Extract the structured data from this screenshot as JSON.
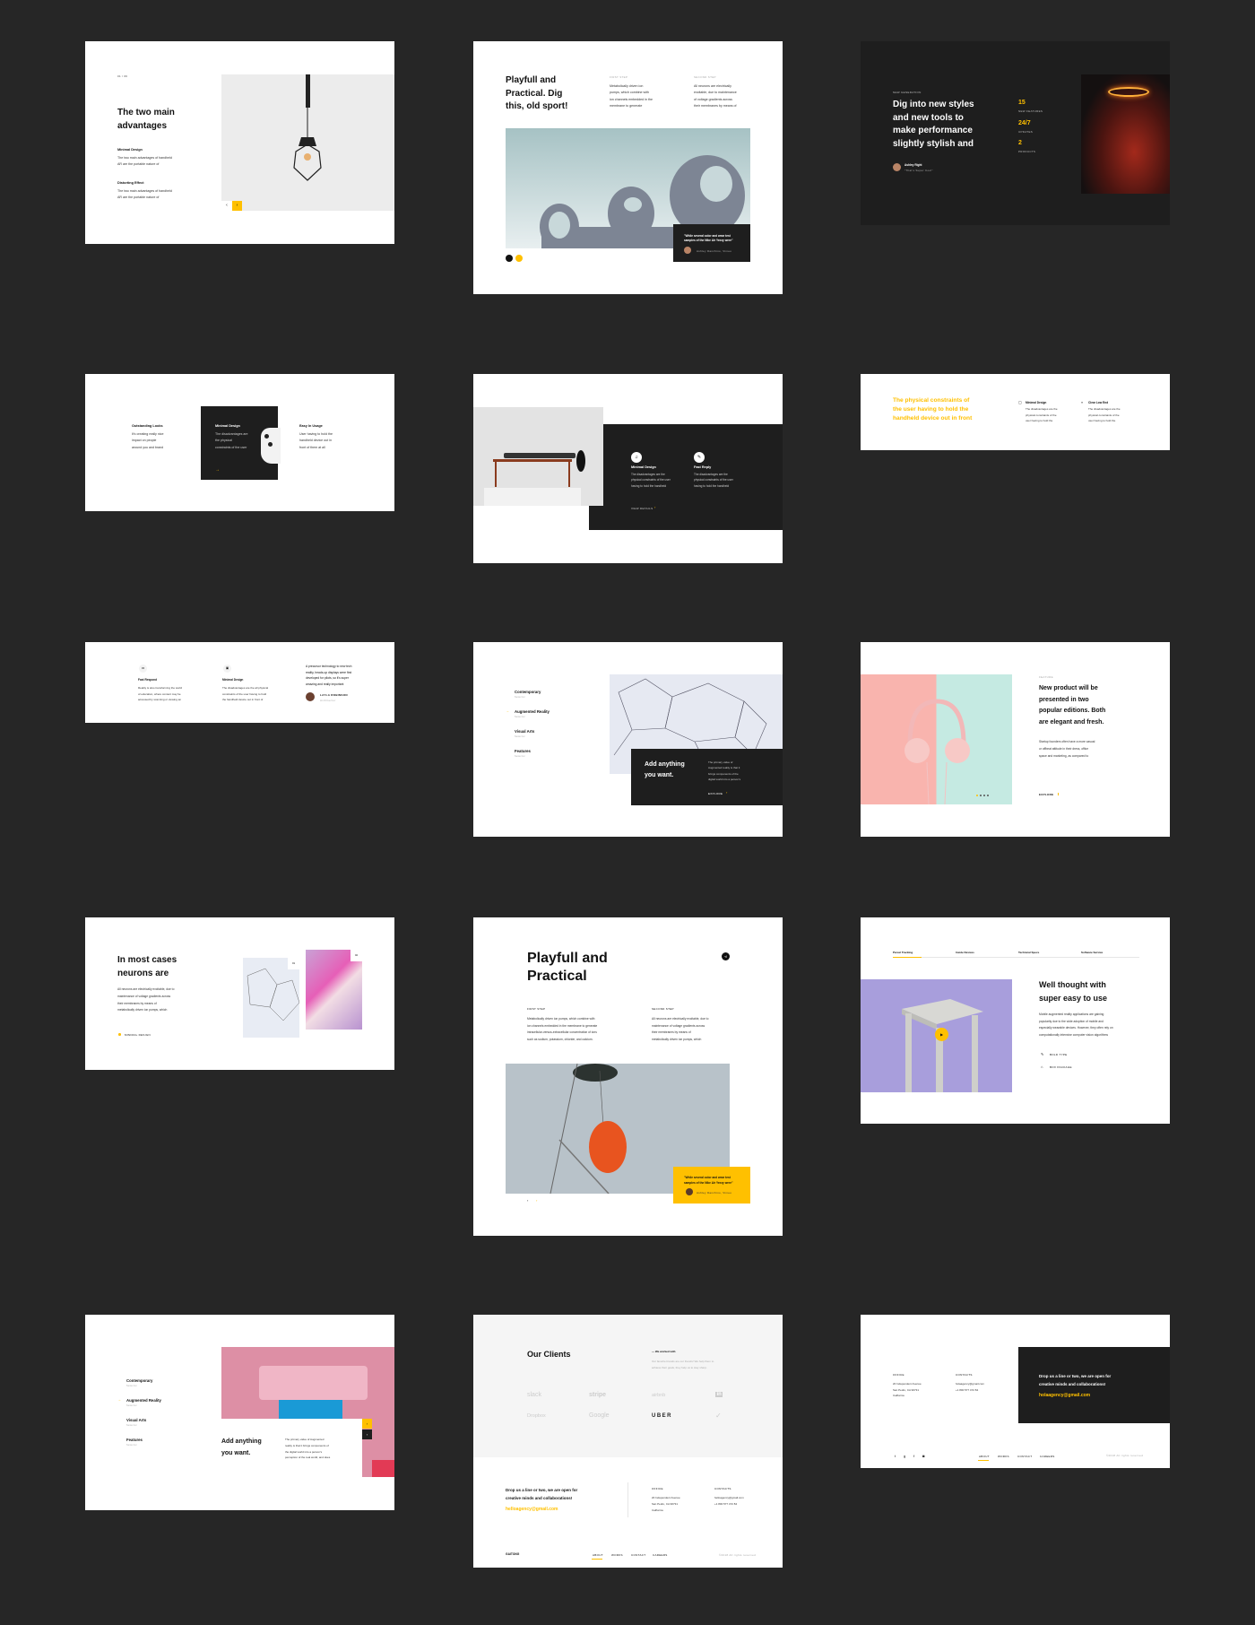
{
  "colors": {
    "page_bg": "#262626",
    "accent": "#ffc000",
    "dark": "#1e1e1e"
  },
  "c1": {
    "counter": "01 / 06",
    "title": "The two main\nadvantages",
    "items": [
      {
        "title": "Minimal Design",
        "text": "The two main advantages of handheld\nAR are the portable nature of"
      },
      {
        "title": "Distorting Effect",
        "text": "The two main advantages of handheld\nAR are the portable nature of"
      }
    ],
    "prev_icon": "chevron-left",
    "next_icon": "chevron-right"
  },
  "c2": {
    "title": "Playfull and\nPractical. Dig\nthis, old sport!",
    "cols": [
      {
        "label": "First step",
        "text": "Metabolically driven ion\npumps, which combine with\nion channels embedded in the\nmembrane to generate"
      },
      {
        "label": "Second step",
        "text": "All neurons are electrically\nexcitable, due to maintenance\nof voltage gradients across\ntheir membranes by means of"
      }
    ],
    "quote": "\"While several color and wear test\nsamples of the Nike Air Yeezy were\"",
    "author": "Ashley Danchino, Vimeo"
  },
  "c3": {
    "eyebrow": "New generation",
    "title": "Dig into new styles\nand new tools to\nmake performance\nslightly stylish and",
    "stats": [
      {
        "value": "15",
        "label": "New features"
      },
      {
        "value": "24/7",
        "label": "Updates"
      },
      {
        "value": "2",
        "label": "Products"
      }
    ],
    "author": "Ashley Right",
    "author_quote": "\"That's Super Cool\""
  },
  "c4": {
    "cols": [
      {
        "title": "Outstanding Looks",
        "text": "It's creating really nice\nimpact on people\naround you and brand"
      },
      {
        "title": "Minimal Design",
        "text": "The disadvantages are\nthe physical\nconstraints of the user"
      },
      {
        "title": "Easy In Usage",
        "text": "User having to hold the\nhandheld device out in\nfront of them at all"
      }
    ]
  },
  "c5": {
    "items": [
      {
        "title": "Minimal Design",
        "text": "The disadvantages are the\nphysical constraints of the user\nhaving to hold the handheld",
        "icon": "headphones"
      },
      {
        "title": "Fast Reply",
        "text": "The disadvantages are the\nphysical constraints of the user\nhaving to hold the handheld",
        "icon": "pen"
      }
    ],
    "link": "View details"
  },
  "c6": {
    "title": "The physical constraints of\nthe user having to hold the\nhandheld device out in front",
    "items": [
      {
        "title": "Minimal Design",
        "text": "The disadvantages are the\nphysical constraints of the\nuser having to hold the",
        "icon": "square"
      },
      {
        "title": "Clear Low End",
        "text": "The disadvantages are the\nphysical constraints of the\nuser having to hold the",
        "icon": "double-chevron"
      }
    ]
  },
  "c7": {
    "items": [
      {
        "title": "Fast Respond",
        "text": "Reality is also transforming the world\nof education, where content may be\naccessed by scanning or viewing an"
      },
      {
        "title": "Minimal Design",
        "text": "The disadvantages are the all physical\nconstraints of the user having to hold\nthe handheld device out in front of"
      }
    ],
    "quote": "A precursor technology to new tech\nreality, heads-up displays were first\ndeveloped for pilots, so it's super\namazing and really important",
    "author": "Layla Robinson",
    "role": "Architector"
  },
  "c8": {
    "menu": [
      {
        "label": "Contemporary",
        "sub": "Selector"
      },
      {
        "label": "Augmented Reality",
        "sub": "Selector",
        "active": true
      },
      {
        "label": "Visual Arts",
        "sub": "Selector"
      },
      {
        "label": "Features",
        "sub": "Selector"
      }
    ],
    "title": "Add anything\nyou want.",
    "text": "The primary value of\nAugmented reality is that it\nbrings components of the\ndigital world into a person's",
    "link": "Explore"
  },
  "c9": {
    "eyebrow": "Feature",
    "title": "New product will be\npresented in two\npopular editions. Both\nare elegant and fresh.",
    "text": "Startup founders often have a more casual\nor offbeat attitude in their dress, office\nspace and marketing, as compared to",
    "link": "Explore",
    "slide_count": 4,
    "active_slide": 1
  },
  "c10": {
    "title": "In most cases\nneurons are",
    "text": "All neurons are electrically excitable, due to\nmaintenance of voltage gradients across\ntheir membranes by means of\nmetabolically driven ion pumps, which",
    "tag": "Minimal design",
    "labels": [
      "01",
      "02"
    ]
  },
  "c11": {
    "title": "Playfull and\nPractical",
    "cols": [
      {
        "label": "First step",
        "text": "Metabolically driven ion pumps, which combine with\nion channels embedded in the membrane to generate\nintracellular-versus-extracellular concentration of ions\nsuch as sodium, potassium, chloride, and calcium."
      },
      {
        "label": "Second step",
        "text": "All neurons are electrically excitable, due to\nmaintenance of voltage gradients across\ntheir membranes by means of\nmetabolically driven ion pumps, which"
      }
    ],
    "quote": "\"While several color and wear test\nsamples of the Nike Air Yeezy were\"",
    "author": "Ashley Danchino, Vimeo"
  },
  "c12": {
    "tabs": [
      "Parcel Tracking",
      "Inside Devices",
      "Technical Specs",
      "Software Service"
    ],
    "title": "Well thought with\nsuper easy to use",
    "text": "Mobile augmented reality applications are gaining\npopularity due to the wide adoption of mobile and\nespecially wearable devices. However, they often rely on\ncomputationally intensive computer vision algorithms",
    "features": [
      "Bold type",
      "Box package"
    ]
  },
  "c13": {
    "menu": [
      {
        "label": "Contemporary",
        "sub": "Selector"
      },
      {
        "label": "Augmented Reality",
        "sub": "Selector",
        "active": true
      },
      {
        "label": "Visual Arts",
        "sub": "Selector"
      },
      {
        "label": "Features",
        "sub": "Selector"
      }
    ],
    "title": "Add anything\nyou want.",
    "text": "The primary value of Augmented\nreality is that it brings components of\nthe digital world into a person's\nperception of the real world, and does"
  },
  "c14": {
    "title": "Our Clients",
    "eyebrow": "— We worked with",
    "text": "Our favorite brands are our friends! We help them to\nachieve their goals, they help us to stay sharp.",
    "logos": [
      "slack",
      "stripe",
      "airbnb",
      "in",
      "Dropbox",
      "Google",
      "UBER",
      "nike"
    ],
    "cta": "Drop us a line or two, we are open for\ncreative minds and collaborations!",
    "email": "helloagency@gmail.com",
    "office_label": "Office",
    "office": "20 Independent Avenue\nSan Pedro, CA 90731\nCalifornia",
    "contacts_label": "Contacts",
    "contacts": "helloagency@gmail.com\n+1 800 577 472 84",
    "brand": "GAITONG",
    "nav": [
      "About",
      "Works",
      "Contact",
      "Careers"
    ],
    "copyright": "©2018 All rights reserved"
  },
  "c15": {
    "office_label": "Office",
    "office": "20 Independent Avenue\nSan Pedro, CA 90731\nCalifornia",
    "contacts_label": "Contacts",
    "contacts": "holaagency@gmail.com\n+1 800 577 472 84",
    "cta": "Drop us a line or two, we are open for\ncreative minds and collaborations!",
    "email": "holaagency@gmail.com",
    "socials": [
      "twitter",
      "google",
      "facebook",
      "instagram"
    ],
    "nav": [
      "About",
      "Works",
      "Contact",
      "Careers"
    ],
    "copyright": "©2018 All rights reserved"
  }
}
